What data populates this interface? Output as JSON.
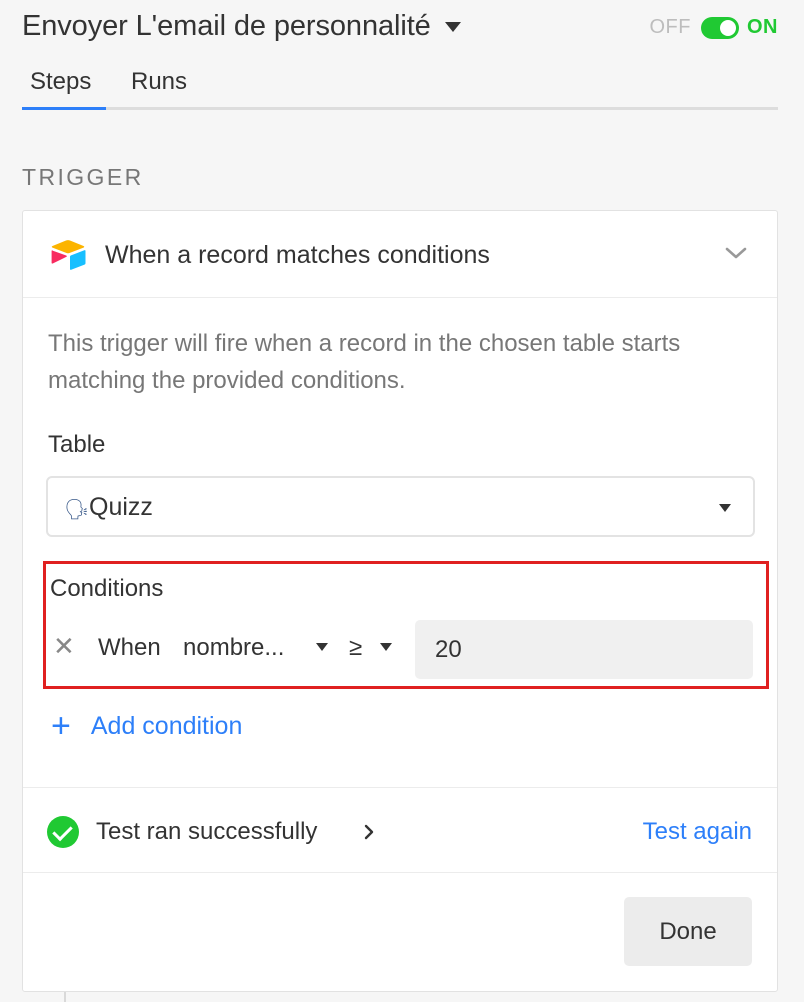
{
  "header": {
    "title": "Envoyer L'email de personnalité",
    "toggle": {
      "off_label": "OFF",
      "on_label": "ON",
      "state": "on"
    }
  },
  "tabs": [
    {
      "label": "Steps",
      "active": true
    },
    {
      "label": "Runs",
      "active": false
    }
  ],
  "section": {
    "label": "TRIGGER"
  },
  "trigger": {
    "title": "When a record matches conditions",
    "description": "This trigger will fire when a record in the chosen table starts matching the provided conditions.",
    "table": {
      "label": "Table",
      "value": "Quizz",
      "icon": "speaking-head-icon"
    },
    "conditions": {
      "label": "Conditions",
      "rows": [
        {
          "when_label": "When",
          "field": "nombre...",
          "operator": "≥",
          "value": "20"
        }
      ],
      "add_label": "Add condition"
    },
    "test": {
      "status": "Test ran successfully",
      "again_label": "Test again"
    },
    "done_label": "Done"
  },
  "colors": {
    "accent": "#2d7ff9",
    "success": "#20c933",
    "highlight": "#e02020"
  }
}
